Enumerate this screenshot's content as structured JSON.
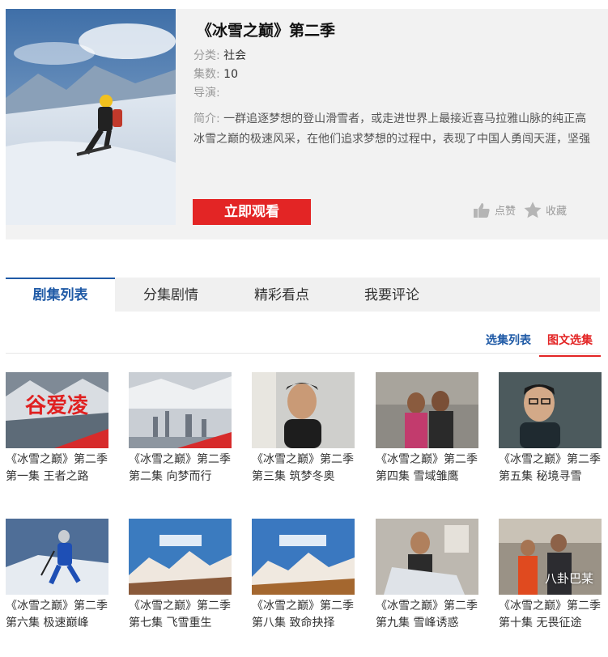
{
  "show": {
    "title": "《冰雪之巅》第二季",
    "category_label": "分类:",
    "category": "社会",
    "episodes_label": "集数:",
    "episodes": "10",
    "director_label": "导演:",
    "director": "",
    "intro_label": "简介:",
    "intro_line1": "一群追逐梦想的登山滑雪者，或走进世界上最接近喜马拉雅山脉的纯正高",
    "intro_line2": "冰雪之巅的极速风采，在他们追求梦想的过程中，表现了中国人勇闯天涯，坚强",
    "watch_label": "立即观看",
    "like_label": "点赞",
    "fav_label": "收藏"
  },
  "tabs": [
    "剧集列表",
    "分集剧情",
    "精彩看点",
    "我要评论"
  ],
  "subnav": [
    "选集列表",
    "图文选集"
  ],
  "overlay_text": "谷爱凌",
  "episodes": [
    {
      "title": "《冰雪之巅》第二季 第一集 王者之路"
    },
    {
      "title": "《冰雪之巅》第二季 第二集 向梦而行"
    },
    {
      "title": "《冰雪之巅》第二季 第三集 筑梦冬奥"
    },
    {
      "title": "《冰雪之巅》第二季 第四集 雪域雏鹰"
    },
    {
      "title": "《冰雪之巅》第二季 第五集 秘境寻雪"
    },
    {
      "title": "《冰雪之巅》第二季 第六集 极速巅峰"
    },
    {
      "title": "《冰雪之巅》第二季 第七集 飞雪重生"
    },
    {
      "title": "《冰雪之巅》第二季 第八集 致命抉择"
    },
    {
      "title": "《冰雪之巅》第二季 第九集 雪峰诱惑"
    },
    {
      "title": "《冰雪之巅》第二季 第十集 无畏征途"
    }
  ],
  "watermark": "八卦巴某",
  "colors": {
    "accent_red": "#e32525",
    "accent_blue": "#1f5aa6"
  }
}
